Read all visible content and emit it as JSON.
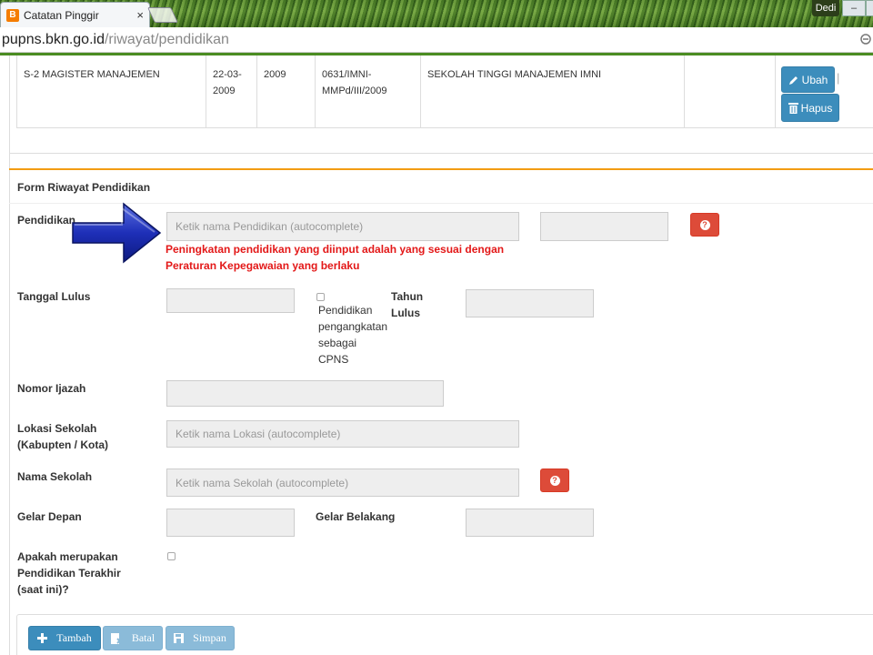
{
  "browser": {
    "tab_title": "Catatan Pinggir",
    "tab_close": "×",
    "user_label": "Dedi",
    "minimize_glyph": "–",
    "url_host": "pupns.bkn.go.id",
    "url_path": "/riwayat/pendidikan"
  },
  "table_row": {
    "tingkat": "S-2 MAGISTER MANAJEMEN",
    "tanggal": "22-03-2009",
    "tahun": "2009",
    "nomor": "0631/IMNI-MMPd/III/2009",
    "sekolah": "SEKOLAH TINGGI MANAJEMEN IMNI",
    "ubah_label": "Ubah",
    "hapus_label": "Hapus",
    "divider": "|"
  },
  "form": {
    "title": "Form Riwayat Pendidikan",
    "pendidikan_label": "Pendidikan",
    "pendidikan_placeholder": "Ketik nama Pendidikan (autocomplete)",
    "pendidikan_warning": "Peningkatan pendidikan yang diinput adalah yang sesuai dengan Peraturan Kepegawaian yang berlaku",
    "tanggal_lulus_label": "Tanggal Lulus",
    "pengangkatan_label": "Pendidikan pengangkatan sebagai CPNS",
    "tahun_lulus_label": "Tahun Lulus",
    "nomor_ijazah_label": "Nomor Ijazah",
    "lokasi_label": "Lokasi Sekolah (Kabupten / Kota)",
    "lokasi_placeholder": "Ketik nama Lokasi (autocomplete)",
    "nama_sekolah_label": "Nama Sekolah",
    "nama_sekolah_placeholder": "Ketik nama Sekolah (autocomplete)",
    "gelar_depan_label": "Gelar Depan",
    "gelar_belakang_label": "Gelar Belakang",
    "terakhir_label": "Apakah merupakan Pendidikan Terakhir (saat ini)?",
    "help_glyph": "?"
  },
  "footer": {
    "tambah_label": "Tambah",
    "batal_label": "Batal",
    "simpan_label": "Simpan"
  },
  "colors": {
    "primary": "#3c8dbc",
    "danger": "#dd4b39",
    "warning_text": "#e31818",
    "accent_rule": "#f39c12"
  },
  "icons": [
    "blogger-icon",
    "pencil-icon",
    "trash-icon",
    "question-icon",
    "plus-icon",
    "cancel-icon",
    "save-icon",
    "arrow-annotation-icon"
  ]
}
